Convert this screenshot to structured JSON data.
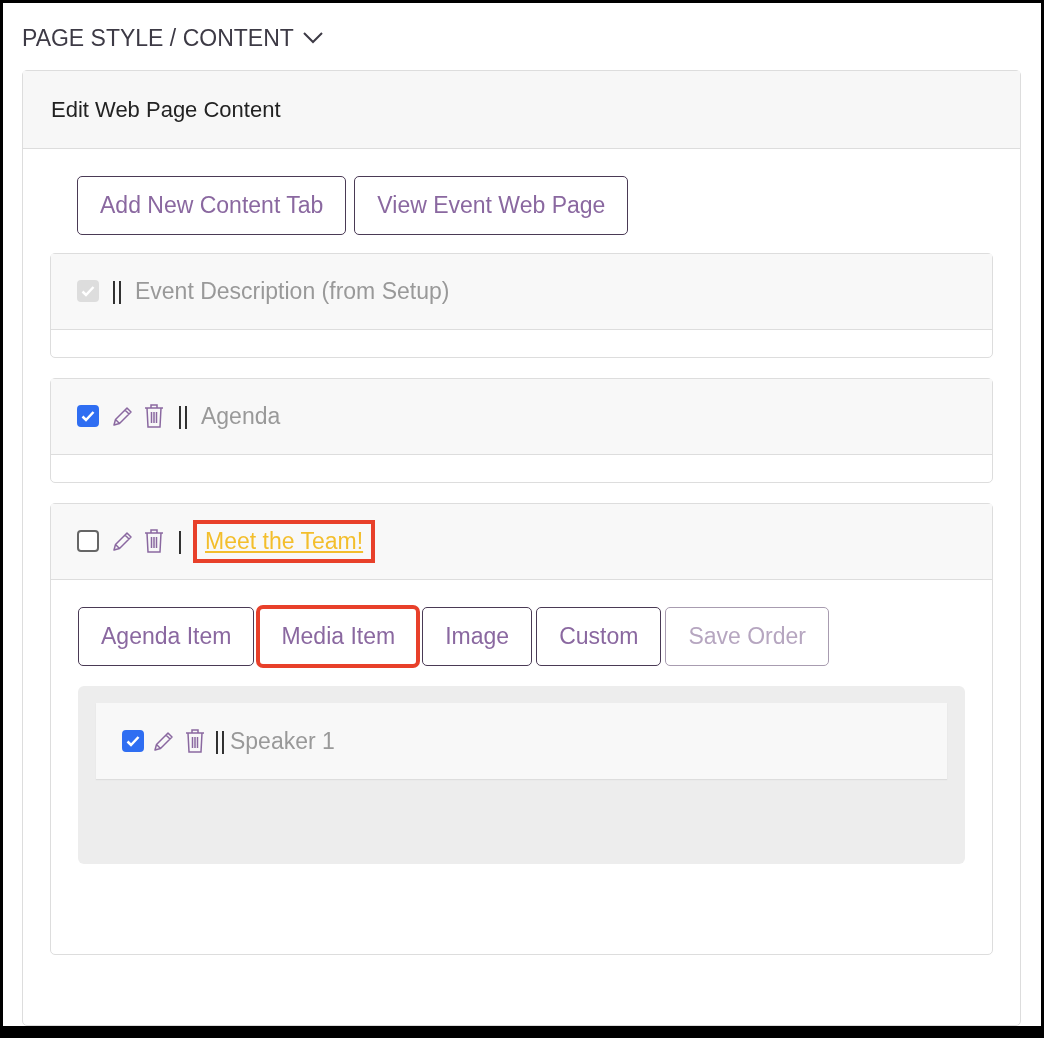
{
  "header": {
    "title": "PAGE STYLE / CONTENT",
    "expanded": true
  },
  "card": {
    "title": "Edit Web Page Content",
    "buttons": [
      {
        "label": "Add New Content Tab"
      },
      {
        "label": "View Event Web Page"
      }
    ],
    "tabs": [
      {
        "handle": "||",
        "title": "Event Description (from Setup)",
        "checked": true,
        "disabled": true,
        "editable": false,
        "link": false,
        "highlighted": false
      },
      {
        "handle": "||",
        "title": "Agenda",
        "checked": true,
        "disabled": false,
        "editable": true,
        "link": false,
        "highlighted": false
      },
      {
        "handle": "|",
        "title": "Meet the Team!",
        "checked": false,
        "disabled": false,
        "editable": true,
        "link": true,
        "highlighted": true,
        "content": {
          "buttons": [
            {
              "label": "Agenda Item",
              "disabled": false,
              "highlighted": false
            },
            {
              "label": "Media Item",
              "disabled": false,
              "highlighted": true
            },
            {
              "label": "Image",
              "disabled": false,
              "highlighted": false
            },
            {
              "label": "Custom",
              "disabled": false,
              "highlighted": false
            },
            {
              "label": "Save Order",
              "disabled": true,
              "highlighted": false
            }
          ],
          "items": [
            {
              "handle": "||",
              "title": "Speaker 1",
              "checked": true
            }
          ]
        }
      }
    ]
  }
}
